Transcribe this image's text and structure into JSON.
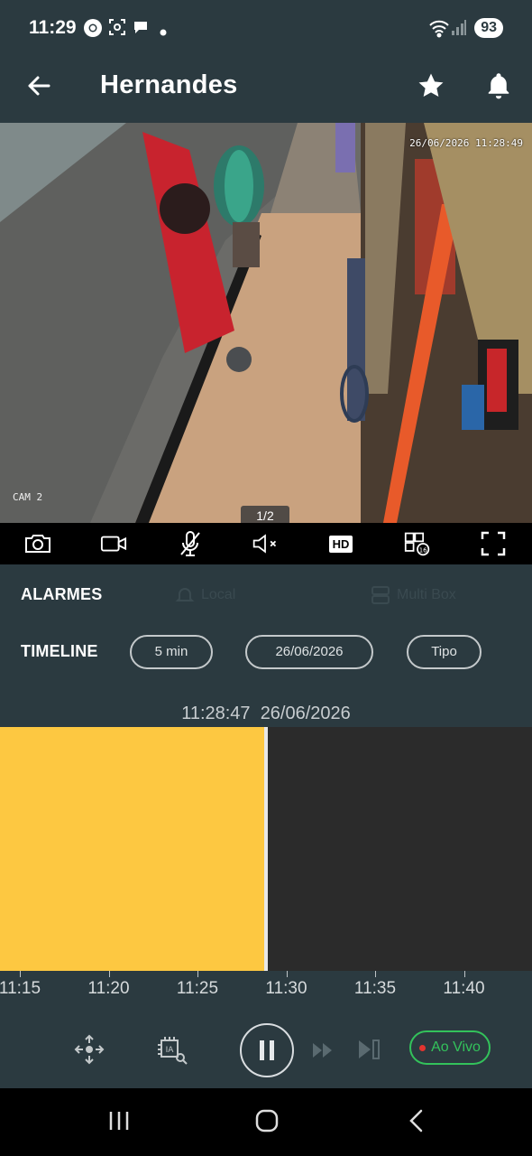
{
  "status_bar": {
    "time": "11:29",
    "battery": "93"
  },
  "header": {
    "title": "Hernandes"
  },
  "video": {
    "timestamp": "26/06/2026 11:28:49",
    "camera_label": "CAM 2",
    "page_indicator": "1/2"
  },
  "toolbar": {
    "hd_label": "HD"
  },
  "alarms": {
    "label": "ALARMES",
    "local_label": "Local",
    "multibox_label": "Multi Box"
  },
  "timeline": {
    "label": "TIMELINE",
    "interval": "5 min",
    "date": "26/06/2026",
    "type": "Tipo",
    "current_time": "11:28:47",
    "current_date": "26/06/2026",
    "recording_end_fraction": 0.5,
    "ticks": [
      "11:15",
      "11:20",
      "11:25",
      "11:30",
      "11:35",
      "11:40"
    ]
  },
  "controls": {
    "live_label": "Ao Vivo"
  },
  "colors": {
    "background": "#2b3a40",
    "recording": "#fdc841",
    "live": "#33c25b"
  }
}
